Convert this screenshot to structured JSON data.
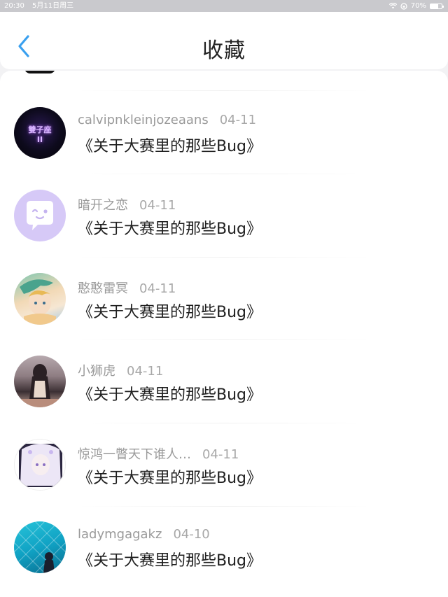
{
  "status_bar": {
    "time": "20:30",
    "date": "5月11日周三",
    "battery": "70%",
    "battery_level": 0.7
  },
  "nav": {
    "title": "收藏",
    "back_icon": "chevron-left-icon",
    "accent_color": "#3aa0ef"
  },
  "items": [
    {
      "name": "calvipnkleinjozeaans",
      "date": "04-11",
      "title": "《关于大赛里的那些Bug》",
      "avatar_text": "雙子座\nII"
    },
    {
      "name": "暗开之恋",
      "date": "04-11",
      "title": "《关于大赛里的那些Bug》"
    },
    {
      "name": "憨憨雷冥",
      "date": "04-11",
      "title": "《关于大赛里的那些Bug》"
    },
    {
      "name": "小狮虎",
      "date": "04-11",
      "title": "《关于大赛里的那些Bug》"
    },
    {
      "name": "惊鸿一瞥天下谁人…",
      "date": "04-11",
      "title": "《关于大赛里的那些Bug》"
    },
    {
      "name": "ladymgagakz",
      "date": "04-10",
      "title": "《关于大赛里的那些Bug》"
    }
  ]
}
